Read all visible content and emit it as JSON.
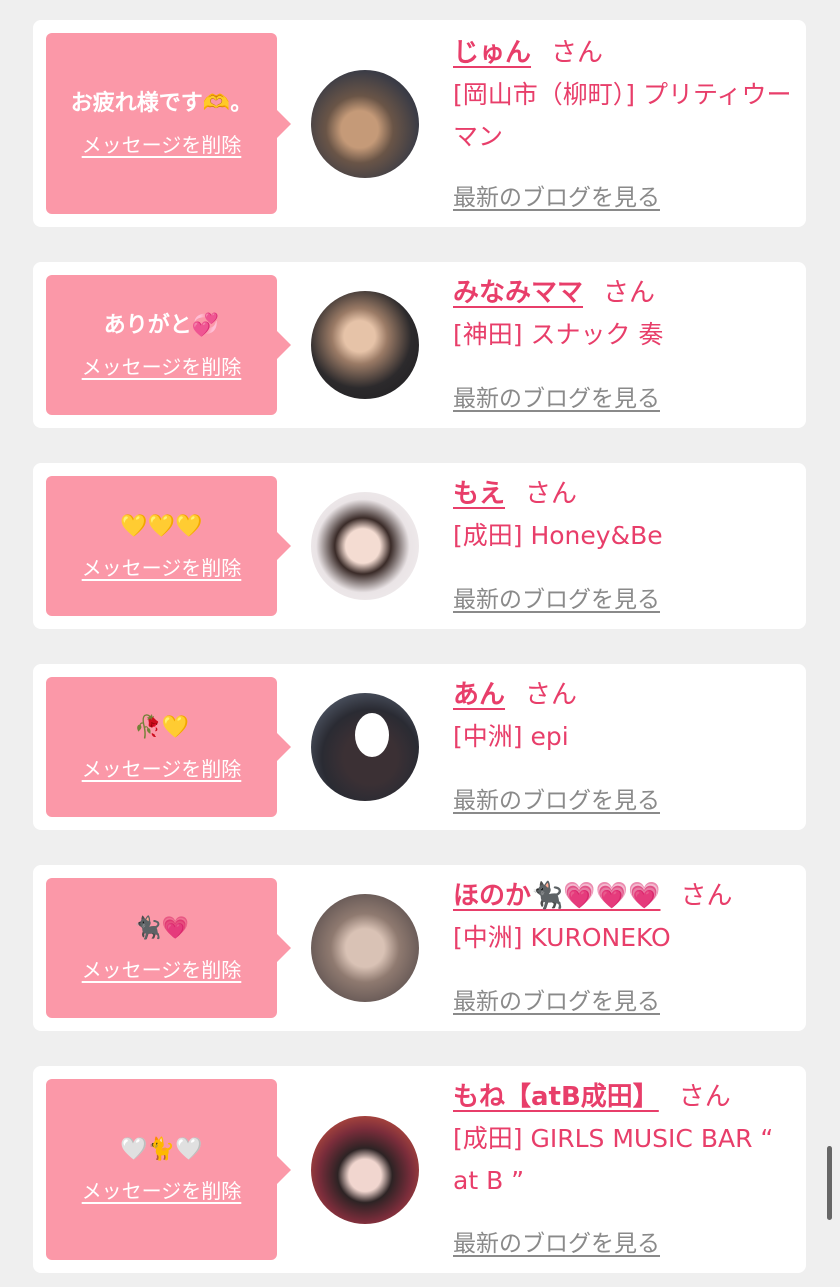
{
  "delete_label": "メッセージを削除",
  "blog_label": "最新のブログを見る",
  "honorific": "さん",
  "items": [
    {
      "message": "お疲れ様です🫶。",
      "name": "じゅん",
      "shop": "[岡山市（柳町）] プリティウーマン",
      "avatar_icon": "avatar-photo"
    },
    {
      "message": "ありがと💞",
      "name": "みなみママ",
      "shop": "[神田] スナック 奏",
      "avatar_icon": "avatar-photo"
    },
    {
      "message": "💛💛💛",
      "name": "もえ",
      "shop": "[成田] Honey&Be",
      "avatar_icon": "avatar-photo"
    },
    {
      "message": "🥀💛",
      "name": "あん",
      "shop": "[中洲] epi",
      "avatar_icon": "avatar-photo"
    },
    {
      "message": "🐈‍⬛💗",
      "name": "ほのか🐈‍⬛💗💗💗",
      "shop": "[中洲] KURONEKO",
      "avatar_icon": "avatar-photo"
    },
    {
      "message": "🤍🐈🤍",
      "name": "もね【atB成田】",
      "shop": "[成田] GIRLS MUSIC BAR “ at B ”",
      "avatar_icon": "avatar-photo"
    }
  ],
  "colors": {
    "accent": "#e83e6a",
    "bubble": "#fb98a8",
    "background": "#efefef",
    "link_gray": "#8a8a8a"
  }
}
